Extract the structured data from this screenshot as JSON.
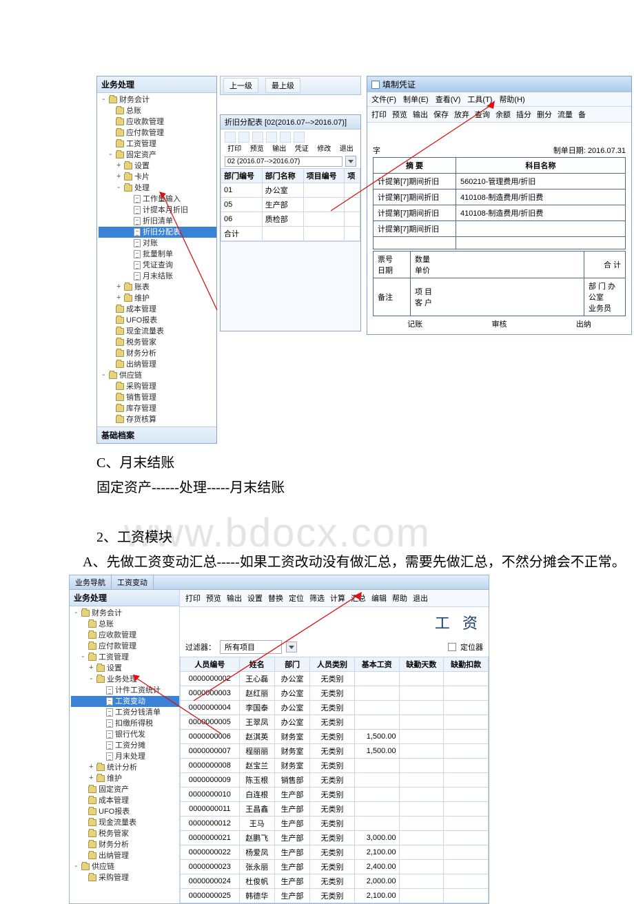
{
  "shot1": {
    "sidebar_title": "业务处理",
    "sidebar_footer": "基础档案",
    "tree": [
      {
        "exp": "-",
        "icon": "folder",
        "indent": 0,
        "label": "财务会计"
      },
      {
        "exp": "",
        "icon": "folder",
        "indent": 1,
        "label": "总账"
      },
      {
        "exp": "",
        "icon": "folder",
        "indent": 1,
        "label": "应收款管理"
      },
      {
        "exp": "",
        "icon": "folder",
        "indent": 1,
        "label": "应付款管理"
      },
      {
        "exp": "",
        "icon": "folder",
        "indent": 1,
        "label": "工资管理"
      },
      {
        "exp": "-",
        "icon": "folder",
        "indent": 1,
        "label": "固定资产"
      },
      {
        "exp": "+",
        "icon": "folder",
        "indent": 2,
        "label": "设置"
      },
      {
        "exp": "+",
        "icon": "folder",
        "indent": 2,
        "label": "卡片"
      },
      {
        "exp": "-",
        "icon": "folder",
        "indent": 2,
        "label": "处理"
      },
      {
        "exp": "",
        "icon": "doc",
        "indent": 3,
        "label": "工作量输入"
      },
      {
        "exp": "",
        "icon": "doc",
        "indent": 3,
        "label": "计提本月折旧"
      },
      {
        "exp": "",
        "icon": "doc",
        "indent": 3,
        "label": "折旧清单"
      },
      {
        "exp": "",
        "icon": "doc",
        "indent": 3,
        "label": "折旧分配表",
        "selected": true
      },
      {
        "exp": "",
        "icon": "doc",
        "indent": 3,
        "label": "对账"
      },
      {
        "exp": "",
        "icon": "doc",
        "indent": 3,
        "label": "批量制单"
      },
      {
        "exp": "",
        "icon": "doc",
        "indent": 3,
        "label": "凭证查询"
      },
      {
        "exp": "",
        "icon": "doc",
        "indent": 3,
        "label": "月末结账"
      },
      {
        "exp": "+",
        "icon": "folder",
        "indent": 2,
        "label": "账表"
      },
      {
        "exp": "+",
        "icon": "folder",
        "indent": 2,
        "label": "维护"
      },
      {
        "exp": "",
        "icon": "folder",
        "indent": 1,
        "label": "成本管理"
      },
      {
        "exp": "",
        "icon": "folder",
        "indent": 1,
        "label": "UFO报表"
      },
      {
        "exp": "",
        "icon": "folder",
        "indent": 1,
        "label": "现金流量表"
      },
      {
        "exp": "",
        "icon": "folder",
        "indent": 1,
        "label": "税务管家"
      },
      {
        "exp": "",
        "icon": "folder",
        "indent": 1,
        "label": "财务分析"
      },
      {
        "exp": "",
        "icon": "folder",
        "indent": 1,
        "label": "出纳管理"
      },
      {
        "exp": "-",
        "icon": "folder",
        "indent": 0,
        "label": "供应链"
      },
      {
        "exp": "",
        "icon": "folder",
        "indent": 1,
        "label": "采购管理"
      },
      {
        "exp": "",
        "icon": "folder",
        "indent": 1,
        "label": "销售管理"
      },
      {
        "exp": "",
        "icon": "folder",
        "indent": 1,
        "label": "库存管理"
      },
      {
        "exp": "",
        "icon": "folder",
        "indent": 1,
        "label": "存货核算"
      }
    ],
    "breadcrumb": {
      "up": "上一级",
      "top": "最上级"
    },
    "distrib_title": "折旧分配表 [02(2016.07-->2016.07)]",
    "toolbar_labels": [
      "打印",
      "预览",
      "输出",
      "凭证",
      "修改",
      "退出"
    ],
    "period_value": "02 (2016.07-->2016.07)",
    "dist_headers": [
      "部门编号",
      "部门名称",
      "项目编号",
      "项"
    ],
    "dist_rows": [
      {
        "no": "01",
        "name": "办公室"
      },
      {
        "no": "05",
        "name": "生产部"
      },
      {
        "no": "06",
        "name": "质检部"
      },
      {
        "no": "合计",
        "name": ""
      }
    ],
    "voucher": {
      "wintitle": "填制凭证",
      "menu": [
        "文件(F)",
        "制单(E)",
        "查看(V)",
        "工具(T)",
        "帮助(H)"
      ],
      "toolbar": [
        "打印",
        "预览",
        "输出",
        "保存",
        "放弃",
        "查询",
        "余额",
        "插分",
        "删分",
        "流量",
        "备"
      ],
      "zi": "字",
      "date_label": "制单日期:",
      "date_value": "2016.07.31",
      "col_digest": "摘 要",
      "col_subject": "科目名称",
      "rows": [
        {
          "d": "计提第[7]期间折旧",
          "s": "560210-管理费用/折旧"
        },
        {
          "d": "计提第[7]期间折旧",
          "s": "410108-制造费用/折旧费"
        },
        {
          "d": "计提第[7]期间折旧",
          "s": "410108-制造费用/折旧费"
        },
        {
          "d": "计提第[7]期间折旧",
          "s": ""
        }
      ],
      "foot_ticket": "票号",
      "foot_date": "日期",
      "foot_qty": "数量",
      "foot_price": "单价",
      "foot_total": "合 计",
      "foot_remark": "备注",
      "foot_proj": "项  目",
      "foot_cust": "客  户",
      "foot_dept": "部  门",
      "foot_deptv": "办公室",
      "foot_emp": "业务员",
      "sign": [
        "记账",
        "审核",
        "出纳"
      ]
    }
  },
  "text": {
    "c_line": "C、月末结账",
    "gd_line": "固定资产------处理-----月末结账",
    "two_line": "2、工资模块",
    "a_line": "    A、先做工资变动汇总-----如果工资改动没有做汇总，需要先做汇总，不然分摊会不正常。",
    "watermark": "www.bdocx.com"
  },
  "shot2": {
    "tabs": [
      "业务导航",
      "工资变动"
    ],
    "sidebar_title": "业务处理",
    "tree": [
      {
        "exp": "-",
        "icon": "folder",
        "indent": 0,
        "label": "财务会计"
      },
      {
        "exp": "",
        "icon": "folder",
        "indent": 1,
        "label": "总账"
      },
      {
        "exp": "",
        "icon": "folder",
        "indent": 1,
        "label": "应收款管理"
      },
      {
        "exp": "",
        "icon": "folder",
        "indent": 1,
        "label": "应付款管理"
      },
      {
        "exp": "-",
        "icon": "folder",
        "indent": 1,
        "label": "工资管理"
      },
      {
        "exp": "+",
        "icon": "folder",
        "indent": 2,
        "label": "设置"
      },
      {
        "exp": "-",
        "icon": "folder",
        "indent": 2,
        "label": "业务处理"
      },
      {
        "exp": "",
        "icon": "doc",
        "indent": 3,
        "label": "计件工资统计"
      },
      {
        "exp": "",
        "icon": "doc",
        "indent": 3,
        "label": "工资变动",
        "selected": true
      },
      {
        "exp": "",
        "icon": "doc",
        "indent": 3,
        "label": "工资分钱清单"
      },
      {
        "exp": "",
        "icon": "doc",
        "indent": 3,
        "label": "扣缴所得税"
      },
      {
        "exp": "",
        "icon": "doc",
        "indent": 3,
        "label": "银行代发"
      },
      {
        "exp": "",
        "icon": "doc",
        "indent": 3,
        "label": "工资分摊"
      },
      {
        "exp": "",
        "icon": "doc",
        "indent": 3,
        "label": "月末处理"
      },
      {
        "exp": "+",
        "icon": "folder",
        "indent": 2,
        "label": "统计分析"
      },
      {
        "exp": "+",
        "icon": "folder",
        "indent": 2,
        "label": "维护"
      },
      {
        "exp": "",
        "icon": "folder",
        "indent": 1,
        "label": "固定资产"
      },
      {
        "exp": "",
        "icon": "folder",
        "indent": 1,
        "label": "成本管理"
      },
      {
        "exp": "",
        "icon": "folder",
        "indent": 1,
        "label": "UFO报表"
      },
      {
        "exp": "",
        "icon": "folder",
        "indent": 1,
        "label": "现金流量表"
      },
      {
        "exp": "",
        "icon": "folder",
        "indent": 1,
        "label": "税务管家"
      },
      {
        "exp": "",
        "icon": "folder",
        "indent": 1,
        "label": "财务分析"
      },
      {
        "exp": "",
        "icon": "folder",
        "indent": 1,
        "label": "出纳管理"
      },
      {
        "exp": "-",
        "icon": "folder",
        "indent": 0,
        "label": "供应链"
      },
      {
        "exp": "",
        "icon": "folder",
        "indent": 1,
        "label": "采购管理"
      }
    ],
    "toolbar": [
      "打印",
      "预览",
      "输出",
      "设置",
      "替换",
      "定位",
      "筛选",
      "计算",
      "汇总",
      "编辑",
      "帮助",
      "退出"
    ],
    "big_title": "工  资",
    "filter": {
      "label": "过滤器：",
      "value": "所有项目",
      "locator": "定位器"
    },
    "headers": [
      "人员编号",
      "姓名",
      "部门",
      "人员类别",
      "基本工资",
      "缺勤天数",
      "缺勤扣款"
    ],
    "rows": [
      {
        "id": "0000000002",
        "name": "王心磊",
        "dept": "办公室",
        "cat": "无类别",
        "base": ""
      },
      {
        "id": "0000000003",
        "name": "赵红丽",
        "dept": "办公室",
        "cat": "无类别",
        "base": ""
      },
      {
        "id": "0000000004",
        "name": "李国泰",
        "dept": "办公室",
        "cat": "无类别",
        "base": ""
      },
      {
        "id": "0000000005",
        "name": "王翠凤",
        "dept": "办公室",
        "cat": "无类别",
        "base": ""
      },
      {
        "id": "0000000006",
        "name": "赵淇英",
        "dept": "财务室",
        "cat": "无类别",
        "base": "1,500.00"
      },
      {
        "id": "0000000007",
        "name": "程丽丽",
        "dept": "财务室",
        "cat": "无类别",
        "base": "1,500.00"
      },
      {
        "id": "0000000008",
        "name": "赵宝兰",
        "dept": "财务室",
        "cat": "无类别",
        "base": ""
      },
      {
        "id": "0000000009",
        "name": "陈玉根",
        "dept": "销售部",
        "cat": "无类别",
        "base": ""
      },
      {
        "id": "0000000010",
        "name": "白连根",
        "dept": "生产部",
        "cat": "无类别",
        "base": ""
      },
      {
        "id": "0000000011",
        "name": "王昌鑫",
        "dept": "生产部",
        "cat": "无类别",
        "base": ""
      },
      {
        "id": "0000000012",
        "name": "王马",
        "dept": "生产部",
        "cat": "无类别",
        "base": ""
      },
      {
        "id": "0000000021",
        "name": "赵鹏飞",
        "dept": "生产部",
        "cat": "无类别",
        "base": "3,000.00"
      },
      {
        "id": "0000000022",
        "name": "杨爱凤",
        "dept": "生产部",
        "cat": "无类别",
        "base": "2,100.00"
      },
      {
        "id": "0000000023",
        "name": "张永丽",
        "dept": "生产部",
        "cat": "无类别",
        "base": "2,400.00"
      },
      {
        "id": "0000000024",
        "name": "杜俊帆",
        "dept": "生产部",
        "cat": "无类别",
        "base": "2,000.00"
      },
      {
        "id": "0000000025",
        "name": "韩德华",
        "dept": "生产部",
        "cat": "无类别",
        "base": "2,100.00"
      }
    ]
  }
}
